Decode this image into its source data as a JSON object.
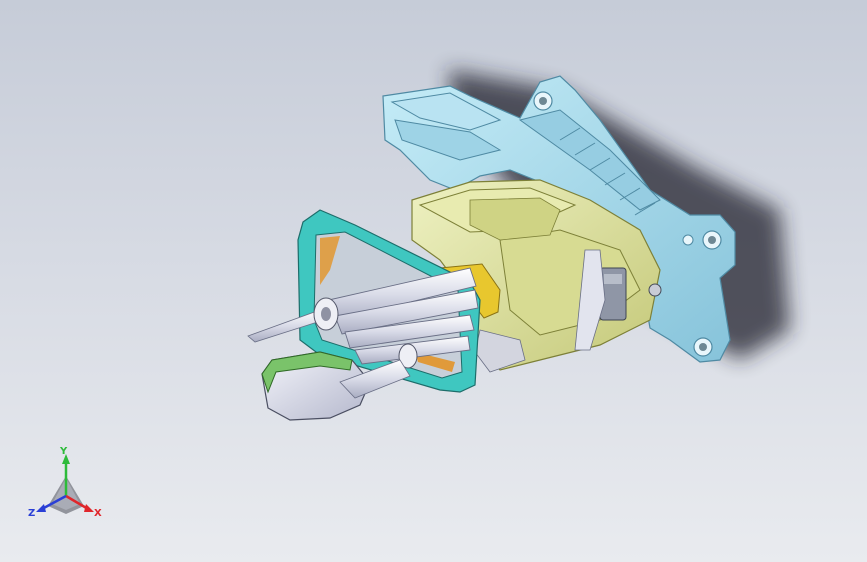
{
  "viewport": {
    "background_top": "#c6ccd8",
    "background_bottom": "#e9ebef"
  },
  "model": {
    "colors": {
      "housing_bracket": "#a8d8ea",
      "housing_edge": "#5b8fa6",
      "gearbox": "#dfe3a3",
      "gearbox_edge": "#8a8d3e",
      "frame": "#3fc7c0",
      "frame_edge": "#1d6d6a",
      "gasket": "#e09a3a",
      "rods": "#e4e6ef",
      "rods_edge": "#6a6f86",
      "boot_trim": "#7ac36a",
      "connector": "#8f96a6",
      "bracket_yellow": "#e8c72e"
    }
  },
  "triad": {
    "y_label": "Y",
    "x_label": "X",
    "z_label": "Z",
    "y_color": "#2dbb3a",
    "x_color": "#e0262b",
    "z_color": "#2a3fd6"
  }
}
